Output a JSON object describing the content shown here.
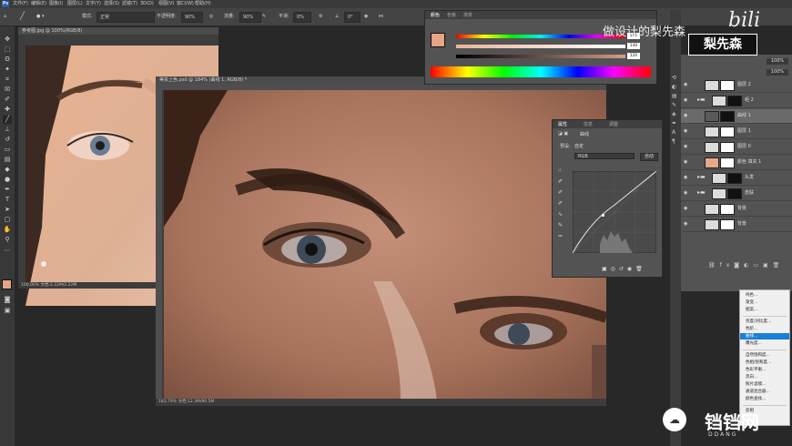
{
  "menubar": {
    "logo": "Ps",
    "items": [
      "文件(F)",
      "编辑(E)",
      "图像(I)",
      "图层(L)",
      "文字(Y)",
      "选择(S)",
      "滤镜(T)",
      "3D(D)",
      "视图(V)",
      "窗口(W)",
      "帮助(H)"
    ]
  },
  "options": {
    "mode_label": "模式:",
    "mode_value": "正常",
    "opacity_label": "不透明度:",
    "opacity_value": "90%",
    "flow_label": "流量:",
    "flow_value": "90%",
    "smooth_label": "平滑:",
    "smooth_value": "0%",
    "angle_value": "0°"
  },
  "docs": {
    "left": {
      "tab": "参考图.jpg @ 100%(RGB/8)",
      "status": "100.00% 文档:2.22M/2.22M"
    },
    "main": {
      "tab": "美妆上色.psd @ 184% (曲线 1, RGB/8) *",
      "status": "183.79% 文档:12.3M/90.5M"
    }
  },
  "color_panel": {
    "tabs": [
      "颜色",
      "色板",
      "渐变"
    ],
    "r_value": "191",
    "g_value": "140",
    "b_value": "120",
    "fg_color": "#e7a586"
  },
  "props": {
    "tabs": [
      "属性",
      "信息",
      "调整"
    ],
    "title": "曲线",
    "preset_label": "预设:",
    "preset_value": "自定",
    "channel_value": "RGB",
    "auto_button": "自动"
  },
  "layers": {
    "zoom_value": "100%",
    "fill_value": "100%",
    "rows": [
      {
        "name": "图层 2",
        "type": "layer"
      },
      {
        "name": "组 2",
        "type": "group"
      },
      {
        "name": "曲线 1",
        "type": "adjust",
        "selected": true
      },
      {
        "name": "图层 1",
        "type": "layer"
      },
      {
        "name": "图层 0",
        "type": "layer"
      },
      {
        "name": "颜色 填充 1",
        "type": "fill"
      },
      {
        "name": "头发",
        "type": "group"
      },
      {
        "name": "皮肤",
        "type": "group"
      },
      {
        "name": "背景",
        "type": "layer"
      },
      {
        "name": "背景",
        "type": "layer"
      }
    ]
  },
  "context_menu": {
    "items": [
      "纯色...",
      "渐变...",
      "图案...",
      "---",
      "亮度/对比度...",
      "色阶...",
      "曲线...",
      "曝光度...",
      "---",
      "自然饱和度...",
      "色相/饱和度...",
      "色彩平衡...",
      "黑白...",
      "照片滤镜...",
      "通道混合器...",
      "颜色查找...",
      "---",
      "反相"
    ],
    "selected": "曲线..."
  },
  "watermarks": {
    "top_text": "做设计的梨先森",
    "bili": "bili",
    "badge": "梨先森",
    "bottom": "铛铛网",
    "bottom_sub": "DDANG"
  }
}
